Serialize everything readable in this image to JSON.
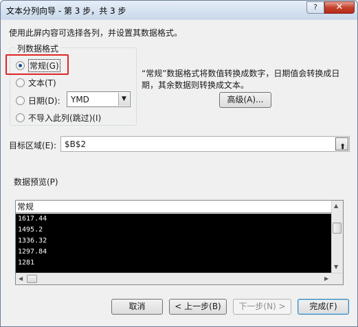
{
  "window": {
    "title": "文本分列向导 - 第 3 步，共 3 步",
    "help_glyph": "?",
    "close_glyph": "✕"
  },
  "instruction": "使用此屏内容可选择各列，并设置其数据格式。",
  "column_format": {
    "group_label": "列数据格式",
    "options": [
      {
        "label": "常规(G)",
        "selected": true
      },
      {
        "label": "文本(T)",
        "selected": false
      },
      {
        "label": "日期(D):",
        "selected": false
      },
      {
        "label": "不导入此列(跳过)(I)",
        "selected": false
      }
    ],
    "date_format_value": "YMD"
  },
  "description": "“常规”数据格式将数值转换成数字，日期值会转换成日期，其余数据则转换成文本。",
  "advanced_button": "高级(A)...",
  "target": {
    "label": "目标区域(E):",
    "value": "$B$2"
  },
  "preview": {
    "label": "数据预览(P)",
    "column_header": "常规",
    "rows": [
      "1617.44",
      "1495.2",
      "1336.32",
      "1297.84",
      "1281"
    ]
  },
  "buttons": {
    "cancel": "取消",
    "back": "< 上一步(B)",
    "next": "下一步(N) >",
    "finish": "完成(F)"
  },
  "colors": {
    "highlight_box": "#e02424",
    "preview_background": "#000000"
  }
}
